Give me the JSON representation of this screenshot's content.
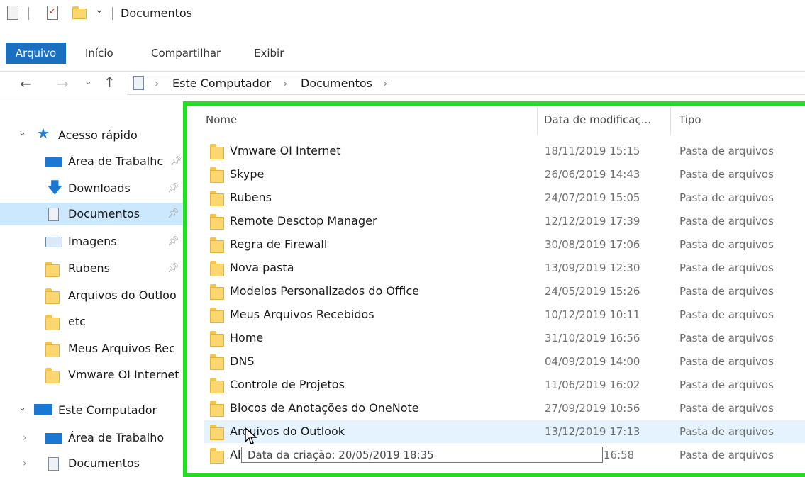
{
  "window": {
    "title": "Documentos"
  },
  "ribbon": {
    "tabs": [
      "Arquivo",
      "Início",
      "Compartilhar",
      "Exibir"
    ]
  },
  "address": {
    "breadcrumb": [
      "Este Computador",
      "Documentos"
    ],
    "separator": "›"
  },
  "sidebar": {
    "quick_access_label": "Acesso rápido",
    "quick_items": [
      {
        "label": "Área de Trabalhc",
        "icon": "desktop-icon",
        "pinned": true
      },
      {
        "label": "Downloads",
        "icon": "download-icon",
        "pinned": true
      },
      {
        "label": "Documentos",
        "icon": "documents-icon",
        "pinned": true,
        "selected": true
      },
      {
        "label": "Imagens",
        "icon": "pictures-icon",
        "pinned": true
      },
      {
        "label": "Rubens",
        "icon": "folder-icon",
        "pinned": true
      },
      {
        "label": "Arquivos do Outloo",
        "icon": "folder-icon"
      },
      {
        "label": "etc",
        "icon": "folder-icon"
      },
      {
        "label": "Meus Arquivos Rec",
        "icon": "folder-icon"
      },
      {
        "label": "Vmware OI Internet",
        "icon": "folder-icon"
      }
    ],
    "this_pc_label": "Este Computador",
    "pc_items": [
      {
        "label": "Área de Trabalho",
        "icon": "desktop-icon"
      },
      {
        "label": "Documentos",
        "icon": "documents-icon"
      }
    ]
  },
  "file_list": {
    "columns": [
      "Nome",
      "Data de modificaç...",
      "Tipo"
    ],
    "rows": [
      {
        "name": "Vmware OI Internet",
        "date": "18/11/2019 15:15",
        "type": "Pasta de arquivos"
      },
      {
        "name": "Skype",
        "date": "26/06/2019 14:43",
        "type": "Pasta de arquivos"
      },
      {
        "name": "Rubens",
        "date": "24/07/2019 15:05",
        "type": "Pasta de arquivos"
      },
      {
        "name": "Remote Desctop Manager",
        "date": "12/12/2019 17:39",
        "type": "Pasta de arquivos"
      },
      {
        "name": "Regra de Firewall",
        "date": "30/08/2019 17:06",
        "type": "Pasta de arquivos"
      },
      {
        "name": "Nova pasta",
        "date": "13/09/2019 12:30",
        "type": "Pasta de arquivos"
      },
      {
        "name": "Modelos Personalizados do Office",
        "date": "24/05/2019 15:26",
        "type": "Pasta de arquivos"
      },
      {
        "name": "Meus Arquivos Recebidos",
        "date": "10/12/2019 10:11",
        "type": "Pasta de arquivos"
      },
      {
        "name": "Home",
        "date": "31/10/2019 16:56",
        "type": "Pasta de arquivos"
      },
      {
        "name": "DNS",
        "date": "04/09/2019 14:00",
        "type": "Pasta de arquivos"
      },
      {
        "name": "Controle de Projetos",
        "date": "11/06/2019 16:02",
        "type": "Pasta de arquivos"
      },
      {
        "name": "Blocos de Anotações do OneNote",
        "date": "27/09/2019 10:56",
        "type": "Pasta de arquivos"
      },
      {
        "name": "Arquivos do Outlook",
        "date": "13/12/2019 17:13",
        "type": "Pasta de arquivos",
        "hover": true
      },
      {
        "name": "Al",
        "date": "16:58",
        "type": "Pasta de arquivos"
      }
    ]
  },
  "tooltip": {
    "text": "Data da criação: 20/05/2019 18:35"
  },
  "colors": {
    "accent": "#1a6fc1",
    "highlight_frame": "#22dd22",
    "selection": "#cce8ff",
    "hover": "#e5f3ff"
  }
}
